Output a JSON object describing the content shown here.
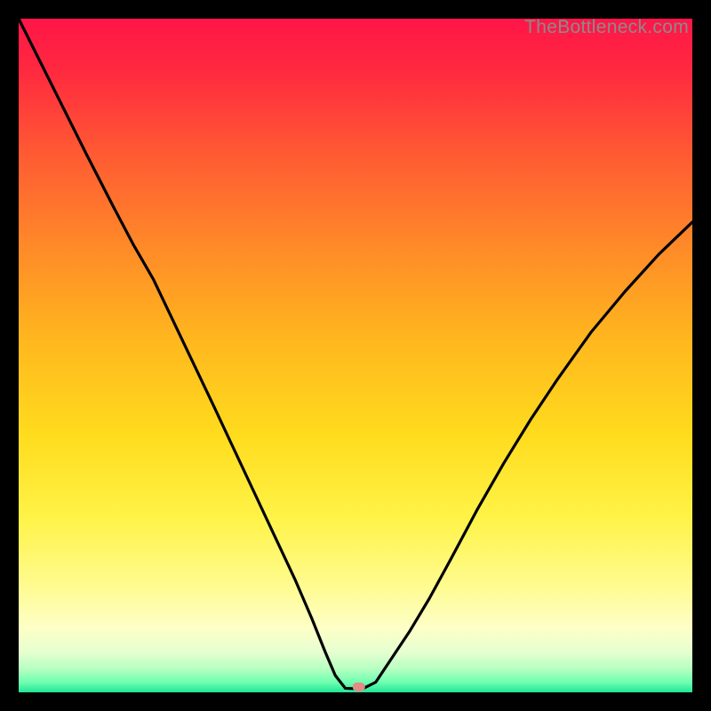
{
  "watermark": "TheBottleneck.com",
  "chart_data": {
    "type": "line",
    "title": "",
    "xlabel": "",
    "ylabel": "",
    "xlim": [
      0,
      100
    ],
    "ylim": [
      0,
      100
    ],
    "grid": false,
    "legend": false,
    "gradient_stops": [
      {
        "offset": 0.0,
        "color": "#ff1548"
      },
      {
        "offset": 0.08,
        "color": "#ff2a3f"
      },
      {
        "offset": 0.2,
        "color": "#ff5a33"
      },
      {
        "offset": 0.34,
        "color": "#ff8a28"
      },
      {
        "offset": 0.48,
        "color": "#ffb81e"
      },
      {
        "offset": 0.62,
        "color": "#ffdc1e"
      },
      {
        "offset": 0.74,
        "color": "#fff347"
      },
      {
        "offset": 0.84,
        "color": "#fffb8e"
      },
      {
        "offset": 0.905,
        "color": "#fdffc7"
      },
      {
        "offset": 0.94,
        "color": "#e6ffd0"
      },
      {
        "offset": 0.965,
        "color": "#b7ffc2"
      },
      {
        "offset": 0.985,
        "color": "#6fffb0"
      },
      {
        "offset": 1.0,
        "color": "#22e596"
      }
    ],
    "series": [
      {
        "name": "bottleneck-curve",
        "x": [
          0.0,
          3.0,
          6.0,
          10.0,
          14.0,
          17.0,
          20.0,
          23.0,
          26.0,
          29.0,
          32.0,
          35.0,
          38.0,
          41.0,
          43.5,
          45.5,
          47.0,
          48.5,
          51.0,
          53.0,
          55.0,
          58.0,
          61.0,
          64.0,
          68.0,
          72.0,
          76.0,
          80.0,
          85.0,
          90.0,
          95.0,
          100.0
        ],
        "y": [
          100.0,
          94.0,
          88.0,
          80.0,
          72.2,
          66.5,
          61.3,
          55.0,
          48.7,
          42.4,
          36.0,
          29.6,
          23.2,
          16.8,
          11.0,
          6.0,
          2.5,
          0.6,
          0.5,
          1.5,
          4.5,
          9.0,
          14.0,
          19.5,
          27.0,
          34.0,
          40.5,
          46.5,
          53.5,
          59.5,
          65.0,
          69.8
        ]
      }
    ],
    "marker": {
      "x": 50.5,
      "y": 0.8,
      "color": "#e58a87"
    }
  }
}
